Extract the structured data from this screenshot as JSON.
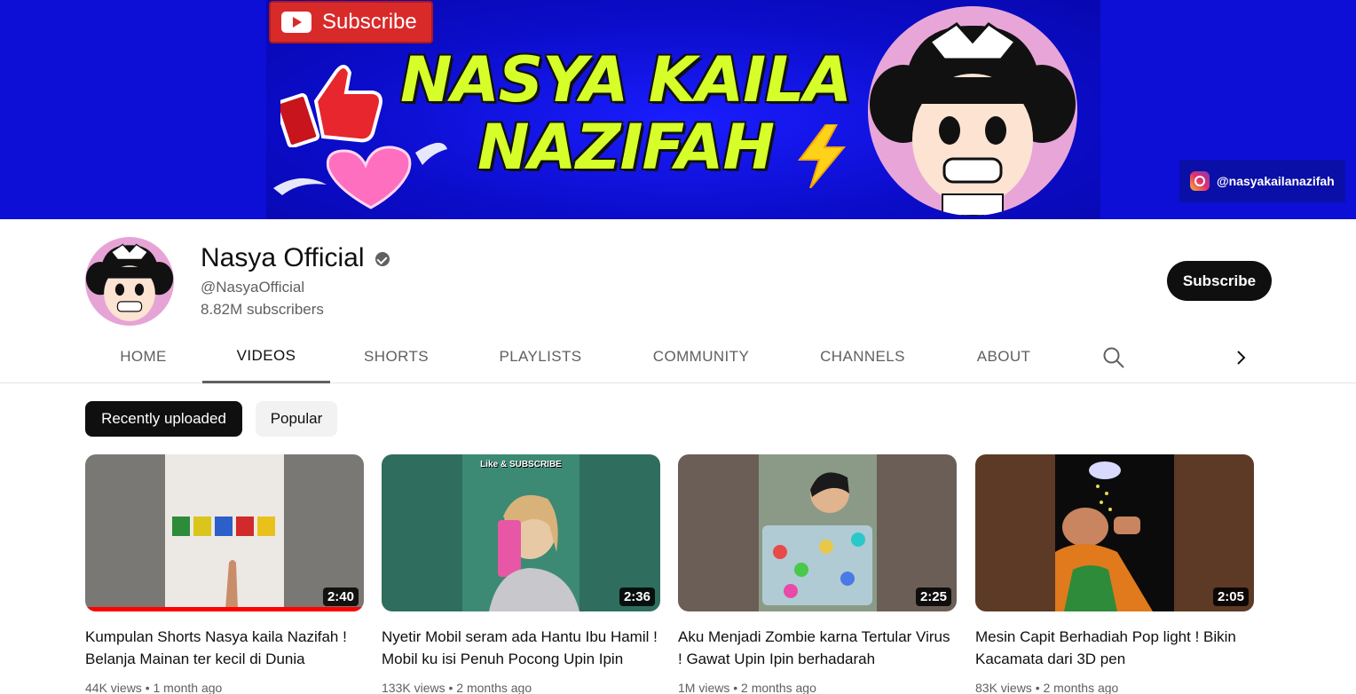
{
  "banner": {
    "subscribe_label": "Subscribe",
    "title_line1": "NASYA KAILA",
    "title_line2": "NAZIFAH",
    "instagram_handle": "@nasyakailanazifah"
  },
  "channel": {
    "name": "Nasya Official",
    "handle": "@NasyaOfficial",
    "subscribers": "8.82M subscribers",
    "subscribe_label": "Subscribe"
  },
  "tabs": [
    {
      "label": "HOME"
    },
    {
      "label": "VIDEOS"
    },
    {
      "label": "SHORTS"
    },
    {
      "label": "PLAYLISTS"
    },
    {
      "label": "COMMUNITY"
    },
    {
      "label": "CHANNELS"
    },
    {
      "label": "ABOUT"
    }
  ],
  "chips": [
    {
      "label": "Recently uploaded"
    },
    {
      "label": "Popular"
    }
  ],
  "videos": [
    {
      "title": "Kumpulan Shorts Nasya kaila Nazifah ! Belanja Mainan ter kecil di Dunia",
      "duration": "2:40",
      "views": "44K views",
      "age": "1 month ago",
      "watch_progress": 1.0
    },
    {
      "title": "Nyetir Mobil seram ada Hantu Ibu Hamil ! Mobil ku isi Penuh Pocong Upin Ipin",
      "duration": "2:36",
      "views": "133K views",
      "age": "2 months ago",
      "thumb_caption": "Like & SUBSCRIBE"
    },
    {
      "title": "Aku Menjadi Zombie karna Tertular Virus ! Gawat Upin Ipin berhadarah",
      "duration": "2:25",
      "views": "1M views",
      "age": "2 months ago"
    },
    {
      "title": "Mesin Capit Berhadiah Pop light ! Bikin Kacamata dari 3D pen",
      "duration": "2:05",
      "views": "83K views",
      "age": "2 months ago"
    }
  ],
  "meta_separator": "•",
  "icons": {
    "verified": "verified-check-icon",
    "search": "search-icon",
    "next": "chevron-right-icon"
  },
  "colors": {
    "banner_bg": "#0d0fd6",
    "banner_title": "#d6ff2a",
    "subscribe_bg": "#0f0f0f",
    "progress": "#ff0000"
  }
}
